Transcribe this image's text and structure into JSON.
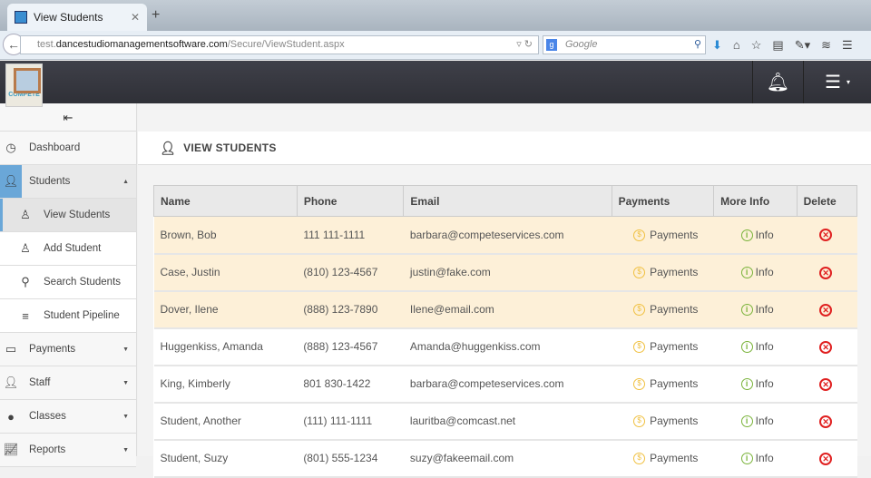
{
  "browser": {
    "tab_title": "View Students",
    "url_prefix": "test.",
    "url_domain": "dancestudiomanagementsoftware.com",
    "url_path": "/Secure/ViewStudent.aspx",
    "search_placeholder": "Google"
  },
  "app": {
    "logo_text": "COMPETE"
  },
  "sidebar": {
    "items": [
      {
        "label": "Dashboard",
        "icon": "dashboard-icon"
      },
      {
        "label": "Students",
        "icon": "user-icon",
        "expanded": true
      },
      {
        "label": "View Students",
        "icon": "students-icon",
        "sub": true,
        "current": true
      },
      {
        "label": "Add Student",
        "icon": "add-student-icon",
        "sub": true
      },
      {
        "label": "Search Students",
        "icon": "search-icon",
        "sub": true
      },
      {
        "label": "Student Pipeline",
        "icon": "pipeline-icon",
        "sub": true
      },
      {
        "label": "Payments",
        "icon": "card-icon"
      },
      {
        "label": "Staff",
        "icon": "staff-icon"
      },
      {
        "label": "Classes",
        "icon": "apple-icon"
      },
      {
        "label": "Reports",
        "icon": "chart-icon"
      }
    ]
  },
  "main": {
    "title": "VIEW STUDENTS",
    "columns": [
      "Name",
      "Phone",
      "Email",
      "Payments",
      "More Info",
      "Delete"
    ],
    "payments_label": "Payments",
    "info_label": "Info",
    "rows": [
      {
        "name": "Brown, Bob",
        "phone": "111 111-1111",
        "email": "barbara@competeservices.com",
        "highlight": true
      },
      {
        "name": "Case, Justin",
        "phone": "(810) 123-4567",
        "email": "justin@fake.com",
        "highlight": true
      },
      {
        "name": "Dover, Ilene",
        "phone": "(888) 123-7890",
        "email": "Ilene@email.com",
        "highlight": true
      },
      {
        "name": "Huggenkiss, Amanda",
        "phone": "(888) 123-4567",
        "email": "Amanda@huggenkiss.com",
        "highlight": false
      },
      {
        "name": "King, Kimberly",
        "phone": "801 830-1422",
        "email": "barbara@competeservices.com",
        "highlight": false
      },
      {
        "name": "Student, Another",
        "phone": "(111) 111-1111",
        "email": "lauritba@comcast.net",
        "highlight": false
      },
      {
        "name": "Student, Suzy",
        "phone": "(801) 555-1234",
        "email": "suzy@fakeemail.com",
        "highlight": false
      }
    ]
  }
}
